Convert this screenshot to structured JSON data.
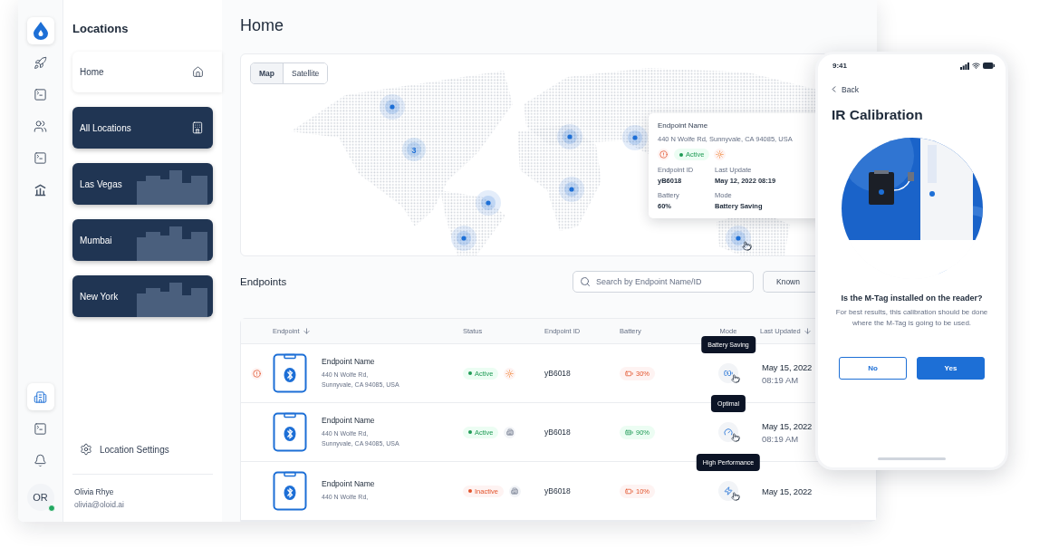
{
  "rail": {
    "top_items": [
      {
        "selected": false
      },
      {
        "selected": false
      },
      {
        "selected": false
      },
      {
        "selected": false
      },
      {
        "selected": false
      }
    ],
    "bottom_items": [
      {
        "selected": true
      },
      {
        "selected": false
      },
      {
        "selected": false
      }
    ],
    "avatar": {
      "initials": "OR",
      "online": true
    }
  },
  "locations": {
    "title": "Locations",
    "items": [
      {
        "label": "Home",
        "kind": "home",
        "selected": true
      },
      {
        "label": "All Locations",
        "kind": "all",
        "selected": false
      },
      {
        "label": "Las Vegas",
        "kind": "city",
        "selected": false
      },
      {
        "label": "Mumbai",
        "kind": "city",
        "selected": false
      },
      {
        "label": "New York",
        "kind": "city",
        "selected": false
      }
    ],
    "settings": "Location Settings",
    "user": {
      "name": "Olivia Rhye",
      "email": "olivia@oloid.ai"
    }
  },
  "main": {
    "title": "Home",
    "map": {
      "view_toggle": [
        {
          "label": "Map",
          "selected": true
        },
        {
          "label": "Satellite",
          "selected": false
        }
      ],
      "cluster_label": "3",
      "popup": {
        "title": "Endpoint Name",
        "address": "440 N Wolfe Rd, Sunnyvale, CA 94085, USA",
        "status": "Active",
        "alert": true,
        "fields": [
          {
            "label": "Endpoint ID",
            "value": "yB6018"
          },
          {
            "label": "Last Update",
            "value": "May 12, 2022 08:19"
          },
          {
            "label": "Battery",
            "value": "60%"
          },
          {
            "label": "Mode",
            "value": "Battery Saving"
          }
        ]
      }
    },
    "endpoints": {
      "title": "Endpoints",
      "search": {
        "placeholder": "Search by Endpoint Name/ID"
      },
      "filters": [
        {
          "label": "Known"
        }
      ],
      "columns": [
        {
          "label": "Endpoint",
          "sortable": true
        },
        {
          "label": "Status",
          "sortable": false
        },
        {
          "label": "Endpoint ID",
          "sortable": false
        },
        {
          "label": "Battery",
          "sortable": false
        },
        {
          "label": "Mode",
          "sortable": false
        },
        {
          "label": "Last Updated",
          "sortable": true
        }
      ],
      "rows": [
        {
          "alert": true,
          "name": "Endpoint Name",
          "address": [
            "440 N Wolfe Rd,",
            "Sunnyvale, CA 94085, USA"
          ],
          "status": "Active",
          "active": true,
          "id": "yB6018",
          "battery": "30%",
          "battery_low": true,
          "mode": "Battery Saving",
          "date": "May 15, 2022",
          "time": "08:19 AM"
        },
        {
          "alert": false,
          "name": "Endpoint Name",
          "address": [
            "440 N Wolfe Rd,",
            "Sunnyvale, CA 94085, USA"
          ],
          "status": "Active",
          "active": true,
          "id": "yB6018",
          "battery": "90%",
          "battery_low": false,
          "mode": "Optimal",
          "date": "May 15, 2022",
          "time": "08:19 AM"
        },
        {
          "alert": false,
          "name": "Endpoint Name",
          "address": [
            "440 N Wolfe Rd,"
          ],
          "status": "Inactive",
          "active": false,
          "id": "yB6018",
          "battery": "10%",
          "battery_low": true,
          "mode": "High Performance",
          "date": "May 15, 2022"
        }
      ]
    }
  },
  "phone": {
    "time": "9:41",
    "back": "Back",
    "title": "IR Calibration",
    "question": "Is the M-Tag installed on the reader?",
    "description": "For best results, this calibration should be done where the M-Tag is going to be used.",
    "buttons": [
      {
        "label": "No",
        "primary": false
      },
      {
        "label": "Yes",
        "primary": true
      }
    ]
  }
}
